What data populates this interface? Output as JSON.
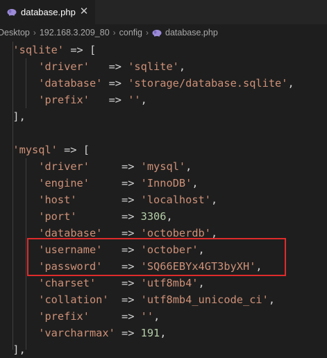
{
  "tab": {
    "filename": "database.php",
    "close_glyph": "✕",
    "icon": "php-elephant-icon"
  },
  "breadcrumb": {
    "items": [
      "Desktop",
      "192.168.3.209_80",
      "config",
      "database.php"
    ],
    "separator": "›"
  },
  "code": {
    "lines": [
      {
        "indent": "  ",
        "tokens": [
          [
            "str",
            "'sqlite'"
          ],
          [
            "op",
            " => ["
          ]
        ]
      },
      {
        "indent": "      ",
        "tokens": [
          [
            "str",
            "'driver'"
          ],
          [
            "op",
            "   => "
          ],
          [
            "str",
            "'sqlite'"
          ],
          [
            "op",
            ","
          ]
        ]
      },
      {
        "indent": "      ",
        "tokens": [
          [
            "str",
            "'database'"
          ],
          [
            "op",
            " => "
          ],
          [
            "str",
            "'storage/database.sqlite'"
          ],
          [
            "op",
            ","
          ]
        ]
      },
      {
        "indent": "      ",
        "tokens": [
          [
            "str",
            "'prefix'"
          ],
          [
            "op",
            "   => "
          ],
          [
            "str",
            "''"
          ],
          [
            "op",
            ","
          ]
        ]
      },
      {
        "indent": "  ",
        "tokens": [
          [
            "op",
            "],"
          ]
        ]
      },
      {
        "indent": "",
        "tokens": []
      },
      {
        "indent": "  ",
        "tokens": [
          [
            "str",
            "'mysql'"
          ],
          [
            "op",
            " => ["
          ]
        ]
      },
      {
        "indent": "      ",
        "tokens": [
          [
            "str",
            "'driver'"
          ],
          [
            "op",
            "     => "
          ],
          [
            "str",
            "'mysql'"
          ],
          [
            "op",
            ","
          ]
        ]
      },
      {
        "indent": "      ",
        "tokens": [
          [
            "str",
            "'engine'"
          ],
          [
            "op",
            "     => "
          ],
          [
            "str",
            "'InnoDB'"
          ],
          [
            "op",
            ","
          ]
        ]
      },
      {
        "indent": "      ",
        "tokens": [
          [
            "str",
            "'host'"
          ],
          [
            "op",
            "       => "
          ],
          [
            "str",
            "'localhost'"
          ],
          [
            "op",
            ","
          ]
        ]
      },
      {
        "indent": "      ",
        "tokens": [
          [
            "str",
            "'port'"
          ],
          [
            "op",
            "       => "
          ],
          [
            "num",
            "3306"
          ],
          [
            "op",
            ","
          ]
        ]
      },
      {
        "indent": "      ",
        "tokens": [
          [
            "str",
            "'database'"
          ],
          [
            "op",
            "   => "
          ],
          [
            "str",
            "'octoberdb'"
          ],
          [
            "op",
            ","
          ]
        ]
      },
      {
        "indent": "      ",
        "tokens": [
          [
            "str",
            "'username'"
          ],
          [
            "op",
            "   => "
          ],
          [
            "str",
            "'october'"
          ],
          [
            "op",
            ","
          ]
        ]
      },
      {
        "indent": "      ",
        "tokens": [
          [
            "str",
            "'password'"
          ],
          [
            "op",
            "   => "
          ],
          [
            "str",
            "'SQ66EBYx4GT3byXH'"
          ],
          [
            "op",
            ","
          ]
        ]
      },
      {
        "indent": "      ",
        "tokens": [
          [
            "str",
            "'charset'"
          ],
          [
            "op",
            "    => "
          ],
          [
            "str",
            "'utf8mb4'"
          ],
          [
            "op",
            ","
          ]
        ]
      },
      {
        "indent": "      ",
        "tokens": [
          [
            "str",
            "'collation'"
          ],
          [
            "op",
            "  => "
          ],
          [
            "str",
            "'utf8mb4_unicode_ci'"
          ],
          [
            "op",
            ","
          ]
        ]
      },
      {
        "indent": "      ",
        "tokens": [
          [
            "str",
            "'prefix'"
          ],
          [
            "op",
            "     => "
          ],
          [
            "str",
            "''"
          ],
          [
            "op",
            ","
          ]
        ]
      },
      {
        "indent": "      ",
        "tokens": [
          [
            "str",
            "'varcharmax'"
          ],
          [
            "op",
            " => "
          ],
          [
            "num",
            "191"
          ],
          [
            "op",
            ","
          ]
        ]
      },
      {
        "indent": "  ",
        "tokens": [
          [
            "op",
            "],"
          ]
        ]
      }
    ]
  },
  "colors": {
    "background": "#1e1e1e",
    "string": "#ce9178",
    "number": "#b5cea8",
    "text": "#d4d4d4",
    "highlight_border": "#e02b2b"
  }
}
